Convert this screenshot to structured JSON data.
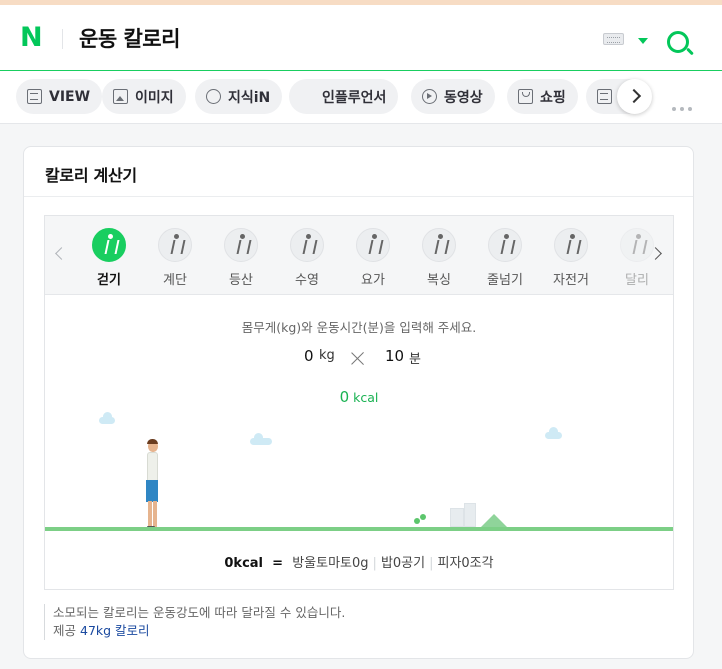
{
  "header": {
    "logo_text": "N",
    "query": "운동 칼로리",
    "accent_color": "#03c75a",
    "icons": [
      "keyboard-icon",
      "dropdown-caret-icon",
      "search-icon"
    ]
  },
  "tabs": [
    {
      "label": "VIEW",
      "icon": "view-icon"
    },
    {
      "label": "이미지",
      "icon": "image-icon"
    },
    {
      "label": "지식iN",
      "icon": "knowledge-icon"
    },
    {
      "label": "인플루언서",
      "icon": "influencer-icon"
    },
    {
      "label": "동영상",
      "icon": "video-play-icon"
    },
    {
      "label": "쇼핑",
      "icon": "shopping-bag-icon"
    },
    {
      "label": "",
      "icon": "news-icon"
    }
  ],
  "calculator": {
    "title": "칼로리 계산기",
    "exercises": [
      {
        "label": "걷기",
        "active": true
      },
      {
        "label": "계단",
        "active": false
      },
      {
        "label": "등산",
        "active": false
      },
      {
        "label": "수영",
        "active": false
      },
      {
        "label": "요가",
        "active": false
      },
      {
        "label": "복싱",
        "active": false
      },
      {
        "label": "줄넘기",
        "active": false
      },
      {
        "label": "자전거",
        "active": false
      },
      {
        "label": "달리",
        "active": false
      }
    ],
    "instruction": "몸무게(kg)와 운동시간(분)을 입력해 주세요.",
    "weight_value": "0",
    "weight_unit": "kg",
    "time_value": "10",
    "time_unit": "분",
    "result_value": "0",
    "result_unit": "kcal",
    "result_color": "#19b252",
    "summary": {
      "kcal": "0kcal",
      "equals": "=",
      "item1": "방울토마토0g",
      "item2": "밥0공기",
      "item3": "피자0조각"
    },
    "note": "소모되는 칼로리는 운동강도에 따라 달라질 수 있습니다.",
    "source_prefix": "제공",
    "source_name": "47kg 칼로리"
  }
}
